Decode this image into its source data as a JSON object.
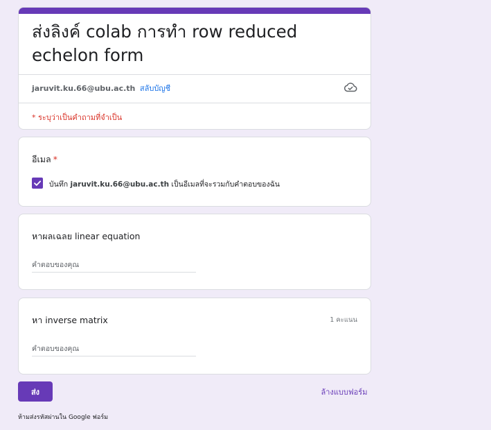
{
  "colors": {
    "background": "#f0ebf8",
    "accent": "#673ab7",
    "required": "#d93025",
    "link": "#1a73e8"
  },
  "header": {
    "title": "ส่งลิงค์ colab การทำ row reduced echelon form",
    "account_email": "jaruvit.ku.66@ubu.ac.th",
    "switch_account_label": "สลับบัญชี",
    "cloud_icon": "cloud-check-icon",
    "required_note": "* ระบุว่าเป็นคำถามที่จำเป็น"
  },
  "email_question": {
    "title": "อีเมล",
    "required_mark": "*",
    "checkbox_checked": true,
    "checkbox_prefix": "บันทึก",
    "checkbox_email": "jaruvit.ku.66@ubu.ac.th",
    "checkbox_suffix": "เป็นอีเมลที่จะรวมกับคำตอบของฉัน"
  },
  "questions": [
    {
      "title": "หาผลเฉลย linear equation",
      "placeholder": "คำตอบของคุณ",
      "value": ""
    },
    {
      "title": "หา inverse matrix",
      "points": "1 คะแนน",
      "placeholder": "คำตอบของคุณ",
      "value": ""
    }
  ],
  "footer": {
    "submit_label": "ส่ง",
    "clear_label": "ล้างแบบฟอร์ม",
    "never_submit_note": "ห้ามส่งรหัสผ่านใน Google ฟอร์ม"
  }
}
